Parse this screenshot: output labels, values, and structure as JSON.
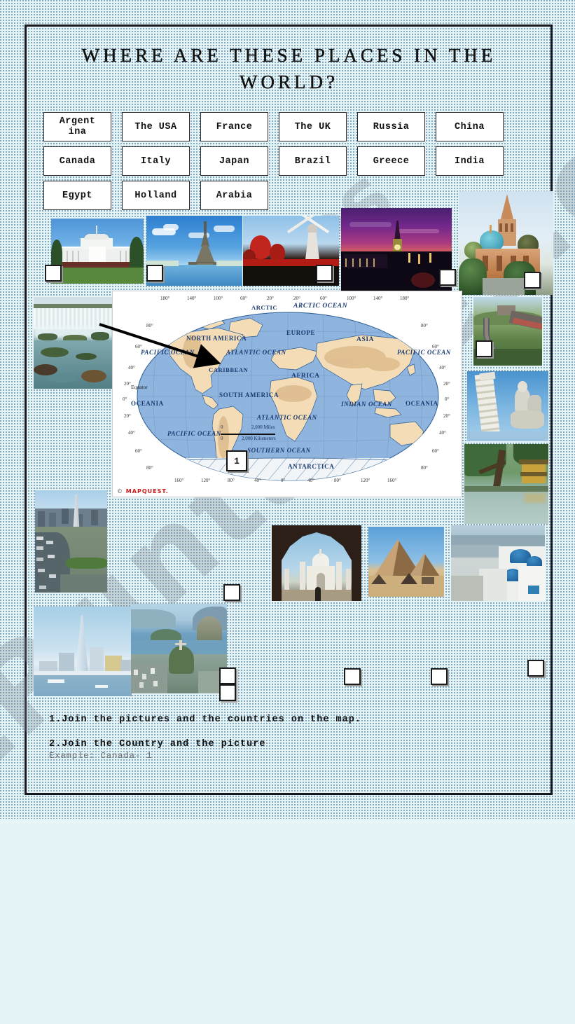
{
  "page": {
    "title": "WHERE ARE THESE PLACES IN THE WORLD?",
    "background_color": "#e4f4f7",
    "frame_color": "#15171c",
    "watermark": "ESLPrintables.com",
    "watermark_short": "es"
  },
  "countries": [
    {
      "label": "Argentina",
      "clipped": true
    },
    {
      "label": "The USA",
      "clipped": false
    },
    {
      "label": "France",
      "clipped": false
    },
    {
      "label": "The UK",
      "clipped": false
    },
    {
      "label": "Russia",
      "clipped": false
    },
    {
      "label": "China",
      "clipped": false
    },
    {
      "label": "Canada",
      "clipped": false
    },
    {
      "label": "Italy",
      "clipped": false
    },
    {
      "label": "Japan",
      "clipped": false
    },
    {
      "label": "Brazil",
      "clipped": false
    },
    {
      "label": "Greece",
      "clipped": false
    },
    {
      "label": "India",
      "clipped": false
    },
    {
      "label": "Egypt",
      "clipped": false
    },
    {
      "label": "Holland",
      "clipped": false
    },
    {
      "label": "Arabia",
      "clipped": false
    }
  ],
  "photos": [
    {
      "name": "photo-white-house",
      "subject": "The White House, Washington"
    },
    {
      "name": "photo-eiffel-tower",
      "subject": "Eiffel Tower, Paris"
    },
    {
      "name": "photo-tulips-windmill",
      "subject": "Tulips and windmill, Holland"
    },
    {
      "name": "photo-big-ben",
      "subject": "Big Ben at sunset, London"
    },
    {
      "name": "photo-st-basils",
      "subject": "St Basil's Cathedral, Moscow"
    },
    {
      "name": "photo-waterfalls",
      "subject": "Iguazu Falls"
    },
    {
      "name": "photo-great-wall",
      "subject": "Great Wall of China"
    },
    {
      "name": "photo-leaning-tower",
      "subject": "Leaning Tower of Pisa"
    },
    {
      "name": "photo-japanese-temple",
      "subject": "Golden Pavilion temple, Japan"
    },
    {
      "name": "photo-obelisco",
      "subject": "Obelisco, Buenos Aires"
    },
    {
      "name": "photo-taj-mahal",
      "subject": "Taj Mahal, India"
    },
    {
      "name": "photo-pyramids",
      "subject": "Pyramids of Giza, Egypt"
    },
    {
      "name": "photo-santorini",
      "subject": "Blue domes, Santorini, Greece"
    },
    {
      "name": "photo-skyline-spire",
      "subject": "City skyline with spire"
    },
    {
      "name": "photo-rio",
      "subject": "Rio de Janeiro, Brazil"
    }
  ],
  "map": {
    "source_logo": "MAPQUEST.",
    "copyright_mark": "©",
    "marker_label": "1",
    "scale_miles_zero": "0",
    "scale_miles": "2,000 Miles",
    "scale_km_zero": "0",
    "scale_km": "2,000 Kilometers",
    "equator_label": "Equator",
    "continents": [
      "NORTH AMERICA",
      "SOUTH AMERICA",
      "EUROPE",
      "ASIA",
      "AFRICA",
      "OCEANIA",
      "OCEANIA",
      "ANTARCTICA",
      "CARIBBEAN",
      "ARCTIC"
    ],
    "oceans": [
      "ARCTIC OCEAN",
      "PACIFIC OCEAN",
      "ATLANTIC OCEAN",
      "PACIFIC OCEAN",
      "ATLANTIC OCEAN",
      "INDIAN OCEAN",
      "PACIFIC OCEAN",
      "SOUTHERN OCEAN"
    ],
    "lon_ticks_top": [
      "180°",
      "140°",
      "100°",
      "60°",
      "20°",
      "20°",
      "60°",
      "100°",
      "140°",
      "180°"
    ],
    "lon_ticks_bottom": [
      "160°",
      "120°",
      "80°",
      "40°",
      "0°",
      "40°",
      "80°",
      "120°",
      "160°"
    ],
    "lat_ticks_left": [
      "80°",
      "60°",
      "40°",
      "20°",
      "0°",
      "20°",
      "40°",
      "60°",
      "80°"
    ],
    "lat_ticks_right": [
      "80°",
      "60°",
      "40°",
      "20°",
      "0°",
      "20°",
      "40°",
      "60°",
      "80°"
    ]
  },
  "instructions": {
    "line1": "1.Join the pictures and the countries on the map.",
    "line2": "2.Join the Country and the picture",
    "example": "Example: Canada- 1"
  },
  "answer_boxes_count": 15
}
